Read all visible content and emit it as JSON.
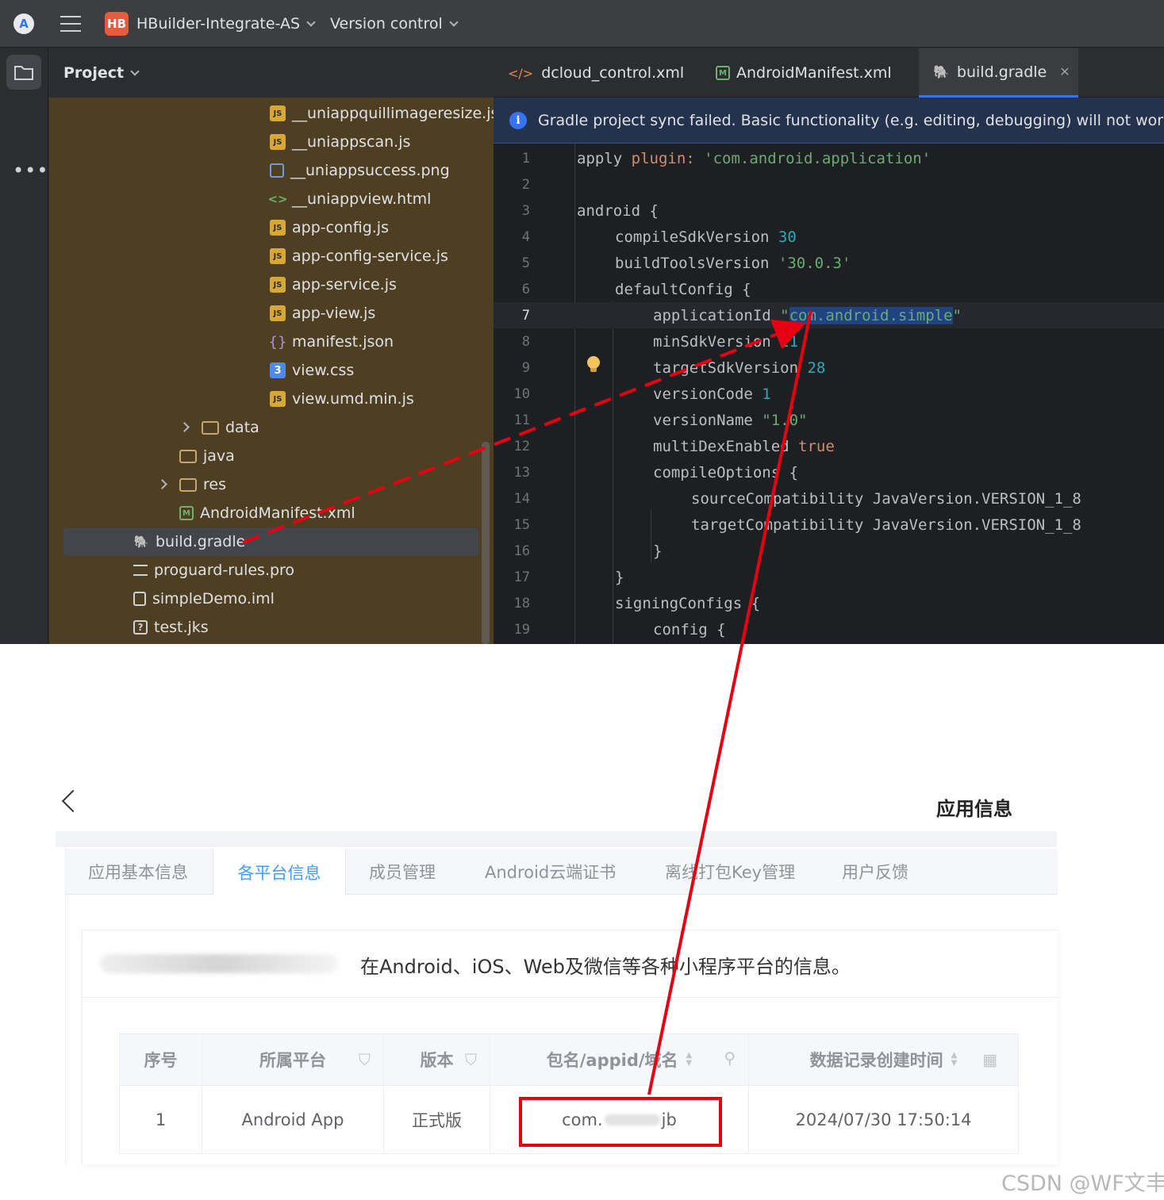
{
  "titlebar": {
    "project_name": "HBuilder-Integrate-AS",
    "project_badge": "HB",
    "vcs_menu": "Version control"
  },
  "project_panel": {
    "title": "Project",
    "tree": [
      {
        "label": "__uniappquillimageresize.js",
        "icon": "js-file-icon"
      },
      {
        "label": "__uniappscan.js",
        "icon": "js-file-icon"
      },
      {
        "label": "__uniappsuccess.png",
        "icon": "image-file-icon"
      },
      {
        "label": "__uniappview.html",
        "icon": "html-file-icon"
      },
      {
        "label": "app-config.js",
        "icon": "js-file-icon"
      },
      {
        "label": "app-config-service.js",
        "icon": "js-file-icon"
      },
      {
        "label": "app-service.js",
        "icon": "js-file-icon"
      },
      {
        "label": "app-view.js",
        "icon": "js-file-icon"
      },
      {
        "label": "manifest.json",
        "icon": "json-file-icon"
      },
      {
        "label": "view.css",
        "icon": "css-file-icon"
      },
      {
        "label": "view.umd.min.js",
        "icon": "js-file-icon"
      },
      {
        "label": "data",
        "icon": "folder-icon"
      },
      {
        "label": "java",
        "icon": "folder-icon"
      },
      {
        "label": "res",
        "icon": "folder-icon"
      },
      {
        "label": "AndroidManifest.xml",
        "icon": "manifest-file-icon"
      },
      {
        "label": "build.gradle",
        "icon": "gradle-file-icon",
        "selected": true
      },
      {
        "label": "proguard-rules.pro",
        "icon": "text-file-icon"
      },
      {
        "label": "simpleDemo.iml",
        "icon": "iml-file-icon"
      },
      {
        "label": "test.jks",
        "icon": "unknown-file-icon"
      }
    ]
  },
  "editor": {
    "tabs": [
      {
        "label": "dcloud_control.xml",
        "icon": "xml-file-icon"
      },
      {
        "label": "AndroidManifest.xml",
        "icon": "manifest-file-icon"
      },
      {
        "label": "build.gradle",
        "icon": "gradle-file-icon",
        "active": true
      }
    ],
    "banner": "Gradle project sync failed. Basic functionality (e.g. editing, debugging) will not work properly",
    "line_numbers": [
      "1",
      "2",
      "3",
      "4",
      "5",
      "6",
      "7",
      "8",
      "9",
      "10",
      "11",
      "12",
      "13",
      "14",
      "15",
      "16",
      "17",
      "18",
      "19"
    ],
    "code": {
      "l1_a": "apply ",
      "l1_b": "plugin: ",
      "l1_c": "'com.android.application'",
      "l3": "android {",
      "l4_a": "compileSdkVersion ",
      "l4_b": "30",
      "l5_a": "buildToolsVersion ",
      "l5_b": "'30.0.3'",
      "l6": "defaultConfig {",
      "l7_a": "applicationId ",
      "l7_q1": "\"",
      "l7_b": "com.android.simple",
      "l7_q2": "\"",
      "l8_a": "minSdkVersion ",
      "l8_b": "21",
      "l9_a": "targetSdkVersion ",
      "l9_b": "28",
      "l10_a": "versionCode ",
      "l10_b": "1",
      "l11_a": "versionName ",
      "l11_b": "\"1.0\"",
      "l12_a": "multiDexEnabled ",
      "l12_b": "true",
      "l13": "compileOptions {",
      "l14": "sourceCompatibility JavaVersion.VERSION_1_8",
      "l15": "targetCompatibility JavaVersion.VERSION_1_8",
      "l16": "}",
      "l17": "}",
      "l18": "signingConfigs {",
      "l19": "config {"
    }
  },
  "web": {
    "title": "应用信息",
    "tabs": [
      "应用基本信息",
      "各平台信息",
      "成员管理",
      "Android云端证书",
      "离线打包Key管理",
      "用户反馈"
    ],
    "description": "在Android、iOS、Web及微信等各种小程序平台的信息。",
    "table": {
      "headers": [
        "序号",
        "所属平台",
        "版本",
        "包名/appid/域名",
        "数据记录创建时间"
      ],
      "row": {
        "index": "1",
        "platform": "Android App",
        "edition": "正式版",
        "package_prefix": "com.",
        "package_suffix": "jb",
        "created": "2024/07/30 17:50:14"
      }
    }
  },
  "watermark": "CSDN @WF文丰",
  "colors": {
    "annotation_red": "#e60012",
    "accent_blue": "#3574f0",
    "web_link_blue": "#409eff"
  }
}
